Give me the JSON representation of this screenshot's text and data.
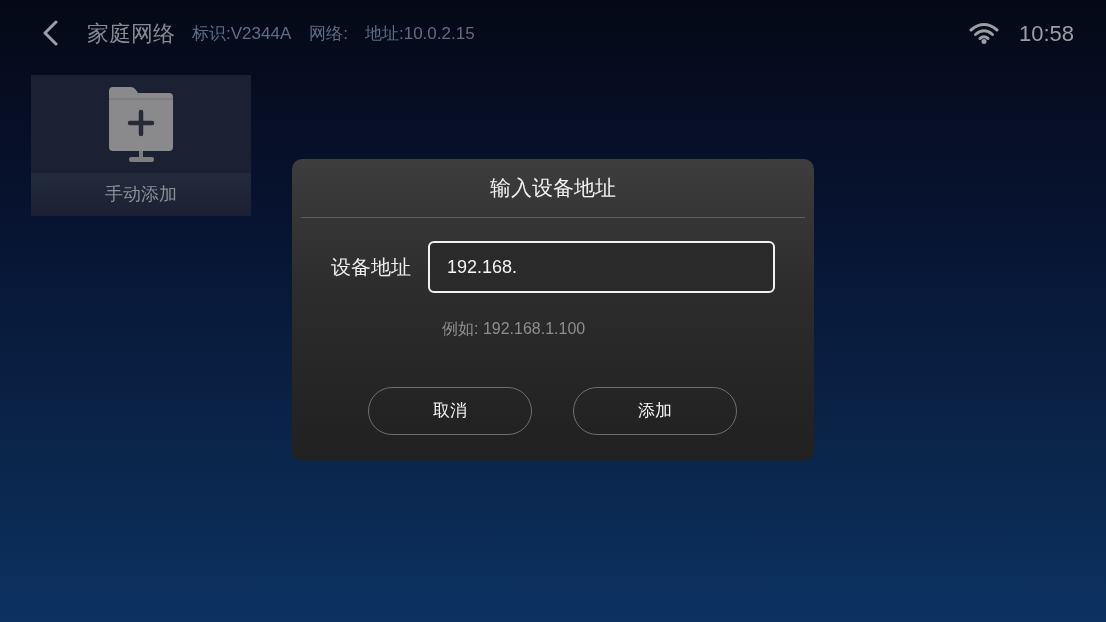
{
  "header": {
    "title": "家庭网络",
    "id_label": "标识:V2344A",
    "network_label": "网络:",
    "address_label": "地址:10.0.2.15"
  },
  "status": {
    "time": "10:58"
  },
  "tiles": [
    {
      "label": "手动添加"
    }
  ],
  "dialog": {
    "title": "输入设备地址",
    "field": {
      "label": "设备地址",
      "value": "192.168."
    },
    "hint": "例如: 192.168.1.100",
    "buttons": [
      {
        "label": "取消"
      },
      {
        "label": "添加"
      }
    ]
  }
}
